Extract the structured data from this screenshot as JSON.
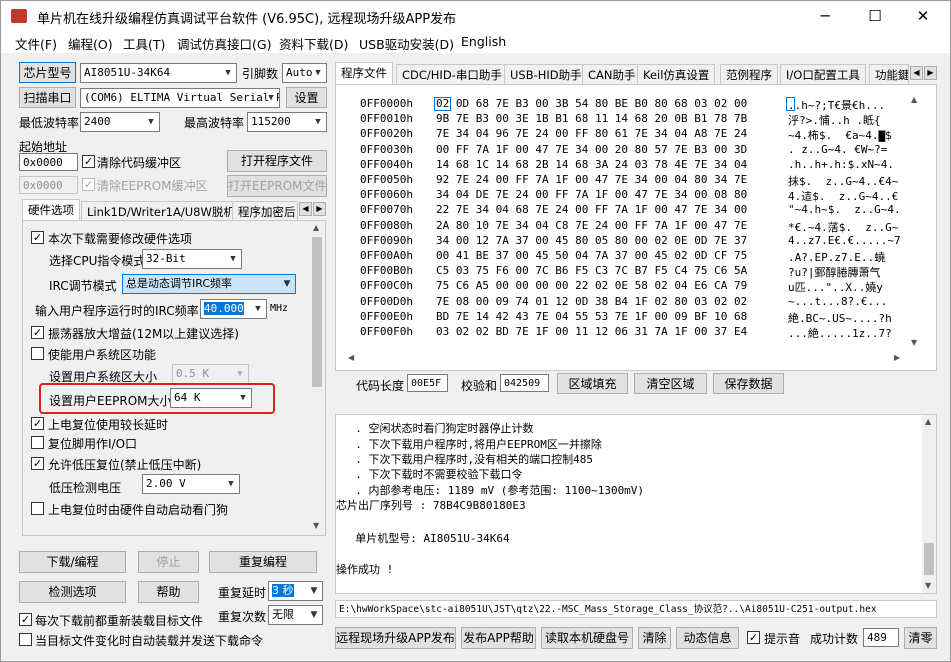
{
  "window": {
    "title": "单片机在线升级编程仿真调试平台软件 (V6.95C), 远程现场升级APP发布",
    "minimize": "─",
    "maximize": "☐",
    "close": "✕"
  },
  "menu": [
    "文件(F)",
    "编程(O)",
    "工具(T)",
    "调试仿真接口(G)",
    "资料下载(D)",
    "USB驱动安装(D)",
    "English"
  ],
  "left": {
    "chip_model_button": "芯片型号",
    "chip_model_value": "AI8051U-34K64",
    "pin_count_label": "引脚数",
    "pin_count_value": "Auto",
    "scan_port_button": "扫描串口",
    "com_port_value": "(COM6) ELTIMA Virtual Serial P",
    "settings_button": "设置",
    "min_baud_label": "最低波特率",
    "min_baud_value": "2400",
    "max_baud_label": "最高波特率",
    "max_baud_value": "115200",
    "start_addr_label": "起始地址",
    "code_start_value": "0x0000",
    "clear_code_label": "清除代码缓冲区",
    "open_program_button": "打开程序文件",
    "eeprom_start_value": "0x0000",
    "clear_eeprom_label": "清除EEPROM缓冲区",
    "open_eeprom_button": "打开EEPROM文件",
    "tabs": [
      "硬件选项",
      "Link1D/Writer1A/U8W脱机",
      "程序加密后"
    ],
    "options": {
      "modify_hw_label": "本次下载需要修改硬件选项",
      "cpu_mode_label": "选择CPU指令模式",
      "cpu_mode_value": "32-Bit",
      "irc_label": "IRC调节模式",
      "irc_value": "总是动态调节IRC频率",
      "irc_freq_label": "输入用户程序运行时的IRC频率",
      "irc_freq_value": "40.000",
      "irc_freq_unit": "MHz",
      "osc_gain_label": "振荡器放大增益(12M以上建议选择)",
      "sys_area_label": "使能用户系统区功能",
      "sys_area_size_label": "设置用户系统区大小",
      "sys_area_size_value": "0.5 K",
      "eeprom_size_label": "设置用户EEPROM大小",
      "eeprom_size_value": "64  K",
      "long_delay_label": "上电复位使用较长延时",
      "reset_io_label": "复位脚用作I/O口",
      "lvr_label": "允许低压复位(禁止低压中断)",
      "lvd_label": "低压检测电压",
      "lvd_value": "2.00 V",
      "wdt_label": "上电复位时由硬件自动启动看门狗"
    },
    "download_button": "下载/编程",
    "stop_button": "停止",
    "reprogram_button": "重复编程",
    "check_option_button": "检测选项",
    "help_button": "帮助",
    "repeat_delay_label": "重复延时",
    "repeat_delay_value": "3 秒",
    "repeat_count_label": "重复次数",
    "repeat_count_value": "无限",
    "reload_label": "每次下载前都重新装载目标文件",
    "auto_send_label": "当目标文件变化时自动装载并发送下载命令"
  },
  "right": {
    "tabs": [
      "程序文件",
      "CDC/HID-串口助手",
      "USB-HID助手",
      "CAN助手",
      "Keil仿真设置",
      "范例程序",
      "I/O口配置工具",
      "功能鍵"
    ],
    "hex_rows": [
      {
        "addr": "0FF0000h",
        "bytes": "02 0D 68 7E B3 00 3B 54 80 BE B0 80 68 03 02 00",
        "ascii": "..h~?;T€景€h..."
      },
      {
        "addr": "0FF0010h",
        "bytes": "9B 7E B3 00 3E 1B B1 68 11 14 68 20 0B B1 78 7B",
        "ascii": "泘?>.悑..h .眡{"
      },
      {
        "addr": "0FF0020h",
        "bytes": "7E 34 04 96 7E 24 00 FF 80 61 7E 34 04 A8 7E 24",
        "ascii": "~4.柨$.  €a~4.▇$"
      },
      {
        "addr": "0FF0030h",
        "bytes": "00 FF 7A 1F 00 47 7E 34 00 20 80 57 7E B3 00 3D",
        "ascii": ". z..G~4. €W~?="
      },
      {
        "addr": "0FF0040h",
        "bytes": "14 68 1C 14 68 2B 14 68 3A 24 03 78 4E 7E 34 04",
        "ascii": ".h..h+.h:$.xN~4."
      },
      {
        "addr": "0FF0050h",
        "bytes": "92 7E 24 00 FF 7A 1F 00 47 7E 34 00 04 80 34 7E",
        "ascii": "抺$.  z..G~4..€4~"
      },
      {
        "addr": "0FF0060h",
        "bytes": "34 04 DE 7E 24 00 FF 7A 1F 00 47 7E 34 00 08 80",
        "ascii": "4.迼$.  z..G~4..€"
      },
      {
        "addr": "0FF0070h",
        "bytes": "22 7E 34 04 68 7E 24 00 FF 7A 1F 00 47 7E 34 00",
        "ascii": "\"~4.h~$.  z..G~4."
      },
      {
        "addr": "0FF0080h",
        "bytes": "2A 80 10 7E 34 04 C8 7E 24 00 FF 7A 1F 00 47 7E",
        "ascii": "*€.~4.萿$.  z..G~"
      },
      {
        "addr": "0FF0090h",
        "bytes": "34 00 12 7A 37 00 45 80 05 80 00 02 0E 0D 7E 37",
        "ascii": "4..z7.E€.€.....~7"
      },
      {
        "addr": "0FF00A0h",
        "bytes": "00 41 BE 37 00 45 50 04 7A 37 00 45 02 0D CF 75",
        "ascii": ".A?.EP.z7.E..蟯"
      },
      {
        "addr": "0FF00B0h",
        "bytes": "C5 03 75 F6 00 7C B6 F5 C3 7C B7 F5 C4 75 C6 5A",
        "ascii": "?u?|鄄醇腃膞萧气"
      },
      {
        "addr": "0FF00C0h",
        "bytes": "75 C6 A5 00 00 00 00 22 02 0E 58 02 04 E6 CA 79",
        "ascii": "u匹...\"..X..嬈y"
      },
      {
        "addr": "0FF00D0h",
        "bytes": "7E 08 00 09 74 01 12 0D 38 B4 1F 02 80 03 02 02",
        "ascii": "~...t...8?.€..."
      },
      {
        "addr": "0FF00E0h",
        "bytes": "BD 7E 14 42 43 7E 04 55 53 7E 1F 00 09 BF 10 68",
        "ascii": "絶.BC~.US~....?h"
      },
      {
        "addr": "0FF00F0h",
        "bytes": "03 02 02 BD 7E 1F 00 11 12 06 31 7A 1F 00 37 E4",
        "ascii": "...絶.....1z..7?"
      }
    ],
    "code_len_label": "代码长度",
    "code_len_value": "00E5F",
    "checksum_label": "校验和",
    "checksum_value": "042509",
    "fill_button": "区域填充",
    "clear_area_button": "清空区域",
    "save_data_button": "保存数据",
    "log_lines": [
      "  . 空闲状态时看门狗定时器停止计数",
      "  . 下次下载用户程序时,将用户EEPROM区一并擦除",
      "  . 下次下载用户程序时,没有相关的端口控制485",
      "  . 下次下载时不需要校验下载口令",
      "  . 内部参考电压: 1189 mV (参考范围: 1100~1300mV)",
      "芯片出厂序列号 : 78B4C9B80180E3",
      "",
      "  单片机型号: AI8051U-34K64",
      "",
      "操作成功 !"
    ],
    "file_path": "E:\\hwWorkSpace\\stc-ai8051U\\JST\\qtz\\22.-MSC_Mass_Storage_Class_协议范?..\\Ai8051U-C251-output.hex",
    "publish_button": "远程现场升级APP发布",
    "publish_help_button": "发布APP帮助",
    "read_disk_button": "读取本机硬盘号",
    "clear_button": "清除",
    "anim_button": "动态信息",
    "beep_label": "提示音",
    "success_count_label": "成功计数",
    "success_count_value": "489",
    "clear_count_button": "清零"
  }
}
